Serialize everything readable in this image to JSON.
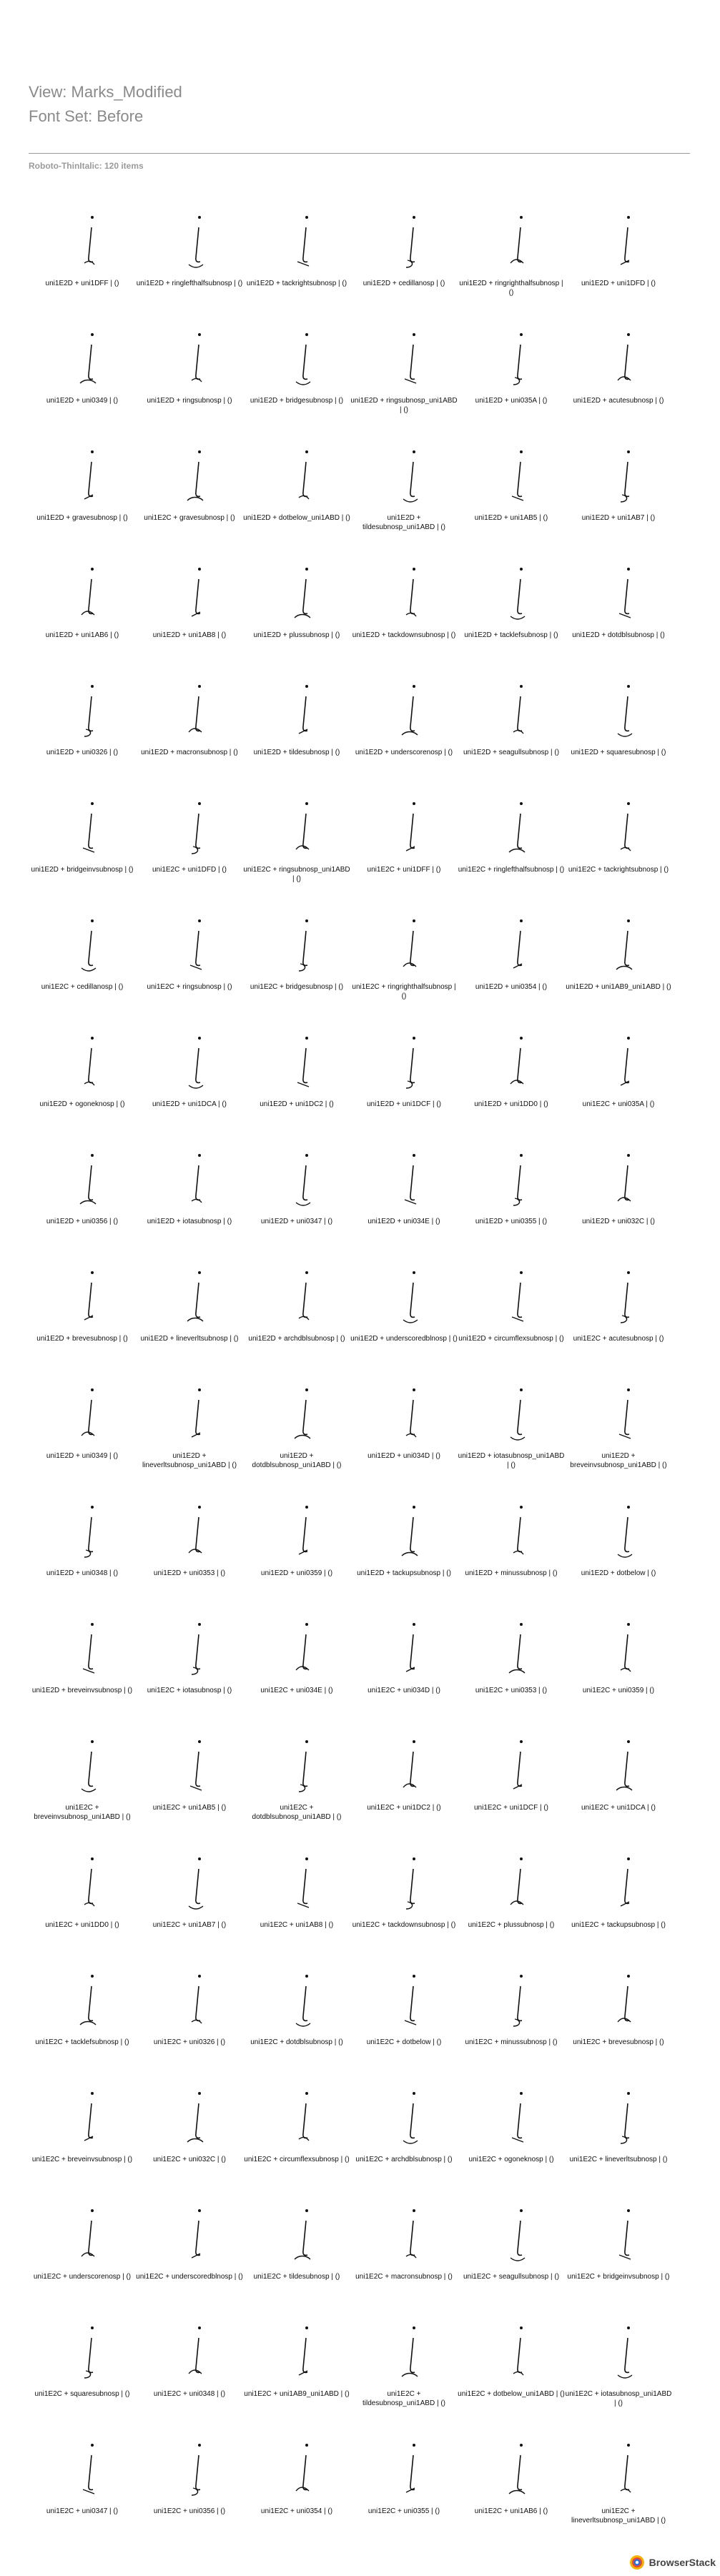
{
  "header": {
    "view": "View: Marks_Modified",
    "font_set": "Font Set: Before"
  },
  "section": {
    "title": "Roboto-ThinItalic: 120 items"
  },
  "items": [
    "uni1E2D + uni1DFF | ()",
    "uni1E2D + ringlefthalfsubnosp | ()",
    "uni1E2D + tackrightsubnosp | ()",
    "uni1E2D + cedillanosp | ()",
    "uni1E2D + ringrighthalfsubnosp | ()",
    "uni1E2D + uni1DFD | ()",
    "uni1E2D + uni0349 | ()",
    "uni1E2D + ringsubnosp | ()",
    "uni1E2D + bridgesubnosp | ()",
    "uni1E2D + ringsubnosp_uni1ABD | ()",
    "uni1E2D + uni035A | ()",
    "uni1E2D + acutesubnosp | ()",
    "uni1E2D + gravesubnosp | ()",
    "uni1E2C + gravesubnosp | ()",
    "uni1E2D + dotbelow_uni1ABD | ()",
    "uni1E2D + tildesubnosp_uni1ABD | ()",
    "uni1E2D + uni1AB5 | ()",
    "uni1E2D + uni1AB7 | ()",
    "uni1E2D + uni1AB6 | ()",
    "uni1E2D + uni1AB8 | ()",
    "uni1E2D + plussubnosp | ()",
    "uni1E2D + tackdownsubnosp | ()",
    "uni1E2D + tacklefsubnosp | ()",
    "uni1E2D + dotdblsubnosp | ()",
    "uni1E2D + uni0326 | ()",
    "uni1E2D + macronsubnosp | ()",
    "uni1E2D + tildesubnosp | ()",
    "uni1E2D + underscorenosp | ()",
    "uni1E2D + seagullsubnosp | ()",
    "uni1E2D + squaresubnosp | ()",
    "uni1E2D + bridgeinvsubnosp | ()",
    "uni1E2C + uni1DFD | ()",
    "uni1E2C + ringsubnosp_uni1ABD | ()",
    "uni1E2C + uni1DFF | ()",
    "uni1E2C + ringlefthalfsubnosp | ()",
    "uni1E2C + tackrightsubnosp | ()",
    "uni1E2C + cedillanosp | ()",
    "uni1E2C + ringsubnosp | ()",
    "uni1E2C + bridgesubnosp | ()",
    "uni1E2C + ringrighthalfsubnosp | ()",
    "uni1E2D + uni0354 | ()",
    "uni1E2D + uni1AB9_uni1ABD | ()",
    "uni1E2D + ogoneknosp | ()",
    "uni1E2D + uni1DCA | ()",
    "uni1E2D + uni1DC2 | ()",
    "uni1E2D + uni1DCF | ()",
    "uni1E2D + uni1DD0 | ()",
    "uni1E2C + uni035A | ()",
    "uni1E2D + uni0356 | ()",
    "uni1E2D + iotasubnosp | ()",
    "uni1E2D + uni0347 | ()",
    "uni1E2D + uni034E | ()",
    "uni1E2D + uni0355 | ()",
    "uni1E2D + uni032C | ()",
    "uni1E2D + brevesubnosp | ()",
    "uni1E2D + lineverltsubnosp | ()",
    "uni1E2D + archdblsubnosp | ()",
    "uni1E2D + underscoredblnosp | ()",
    "uni1E2D + circumflexsubnosp | ()",
    "uni1E2C + acutesubnosp | ()",
    "uni1E2D + uni0349 | ()",
    "uni1E2D + lineverltsubnosp_uni1ABD | ()",
    "uni1E2D + dotdblsubnosp_uni1ABD | ()",
    "uni1E2D + uni034D | ()",
    "uni1E2D + iotasubnosp_uni1ABD | ()",
    "uni1E2D + breveinvsubnosp_uni1ABD | ()",
    "uni1E2D + uni0348 | ()",
    "uni1E2D + uni0353 | ()",
    "uni1E2D + uni0359 | ()",
    "uni1E2D + tackupsubnosp | ()",
    "uni1E2D + minussubnosp | ()",
    "uni1E2D + dotbelow | ()",
    "uni1E2D + breveinvsubnosp | ()",
    "uni1E2C + iotasubnosp | ()",
    "uni1E2C + uni034E | ()",
    "uni1E2C + uni034D | ()",
    "uni1E2C + uni0353 | ()",
    "uni1E2C + uni0359 | ()",
    "uni1E2C + breveinvsubnosp_uni1ABD | ()",
    "uni1E2C + uni1AB5 | ()",
    "uni1E2C + dotdblsubnosp_uni1ABD | ()",
    "uni1E2C + uni1DC2 | ()",
    "uni1E2C + uni1DCF | ()",
    "uni1E2C + uni1DCA | ()",
    "uni1E2C + uni1DD0 | ()",
    "uni1E2C + uni1AB7 | ()",
    "uni1E2C + uni1AB8 | ()",
    "uni1E2C + tackdownsubnosp | ()",
    "uni1E2C + plussubnosp | ()",
    "uni1E2C + tackupsubnosp | ()",
    "uni1E2C + tacklefsubnosp | ()",
    "uni1E2C + uni0326 | ()",
    "uni1E2C + dotdblsubnosp | ()",
    "uni1E2C + dotbelow | ()",
    "uni1E2C + minussubnosp | ()",
    "uni1E2C + brevesubnosp | ()",
    "uni1E2C + breveinvsubnosp | ()",
    "uni1E2C + uni032C | ()",
    "uni1E2C + circumflexsubnosp | ()",
    "uni1E2C + archdblsubnosp | ()",
    "uni1E2C + ogoneknosp | ()",
    "uni1E2C + lineverltsubnosp | ()",
    "uni1E2C + underscorenosp | ()",
    "uni1E2C + underscoredblnosp | ()",
    "uni1E2C + tildesubnosp | ()",
    "uni1E2C + macronsubnosp | ()",
    "uni1E2C + seagullsubnosp | ()",
    "uni1E2C + bridgeinvsubnosp | ()",
    "uni1E2C + squaresubnosp | ()",
    "uni1E2C + uni0348 | ()",
    "uni1E2C + uni1AB9_uni1ABD | ()",
    "uni1E2C + tildesubnosp_uni1ABD | ()",
    "uni1E2C + dotbelow_uni1ABD | ()",
    "uni1E2C + iotasubnosp_uni1ABD | ()",
    "uni1E2C + uni0347 | ()",
    "uni1E2C + uni0356 | ()",
    "uni1E2C + uni0354 | ()",
    "uni1E2C + uni0355 | ()",
    "uni1E2C + uni1AB6 | ()",
    "uni1E2C + lineverltsubnosp_uni1ABD | ()"
  ],
  "footer": {
    "brand": "BrowserStack"
  }
}
